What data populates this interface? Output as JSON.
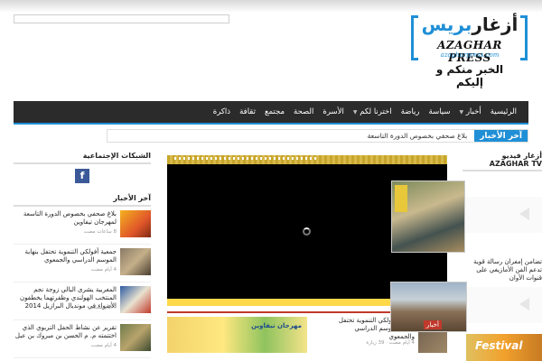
{
  "site": {
    "logo_arabic_part1": "أزغار",
    "logo_arabic_part2": "بريس",
    "logo_english": "AZAGHAR PRESS",
    "logo_url": "azagharpress.com",
    "slogan": "الخبر منكم و إليكم"
  },
  "nav": {
    "items": [
      {
        "label": "الرئيسية"
      },
      {
        "label": "أخبار",
        "has_dropdown": true
      },
      {
        "label": "سياسة"
      },
      {
        "label": "رياضة"
      },
      {
        "label": "اخترنا لكم",
        "has_dropdown": true
      },
      {
        "label": "الأسرة"
      },
      {
        "label": "الصحة"
      },
      {
        "label": "مجتمع"
      },
      {
        "label": "ثقافة"
      },
      {
        "label": "ذاكرة"
      }
    ]
  },
  "ticker": {
    "label": "آخر الأخبار",
    "text": "بلاغ صحفي بخصوص الدورة التاسعة"
  },
  "social": {
    "title": "الشبكات الإجتماعية",
    "facebook_glyph": "f"
  },
  "latest_news": {
    "title": "آخر الأخبار",
    "items": [
      {
        "text": "بلاغ صحفي بخصوص الدورة التاسعة لمهرجان تيفاوين",
        "meta": "8 ساعات مضت"
      },
      {
        "text": "جمعية أفولكي التنموية تحتفل بنهاية الموسم الدراسي والجمعوي",
        "meta": "4 أيام مضت"
      },
      {
        "text": "المغربية يشرى البالي زوجة نجم المنتخب الهولندي وظفرتهما يخطفون الأضواء في مونديال البرازيل 2014",
        "meta": "4 أيام مضت"
      },
      {
        "text": "تقرير عن نشاط الحفل التربوي الذي اختتمته م. م الحسن بن مبروك بن عبل",
        "meta": "4 أيام مضت"
      }
    ]
  },
  "featured": {
    "sub_title": "جمعية أفولكي التنموية تحتفل بنهاية الموسم الدراسي والجمعوي",
    "sub_meta": "4 أيام مضت · 39 زيارة",
    "sub2_tag": "مهرجان تيفاوين"
  },
  "video_widget": {
    "title": "أزغار فيديو AZAGHAR TV",
    "captions": [
      {
        "text": "تضامن إمغران رسالة قوية تدعم الفن الأمازيغي على قنوات الأوان"
      }
    ]
  },
  "popups": {
    "news_label": "أخبار",
    "festival_text": "Festival"
  }
}
